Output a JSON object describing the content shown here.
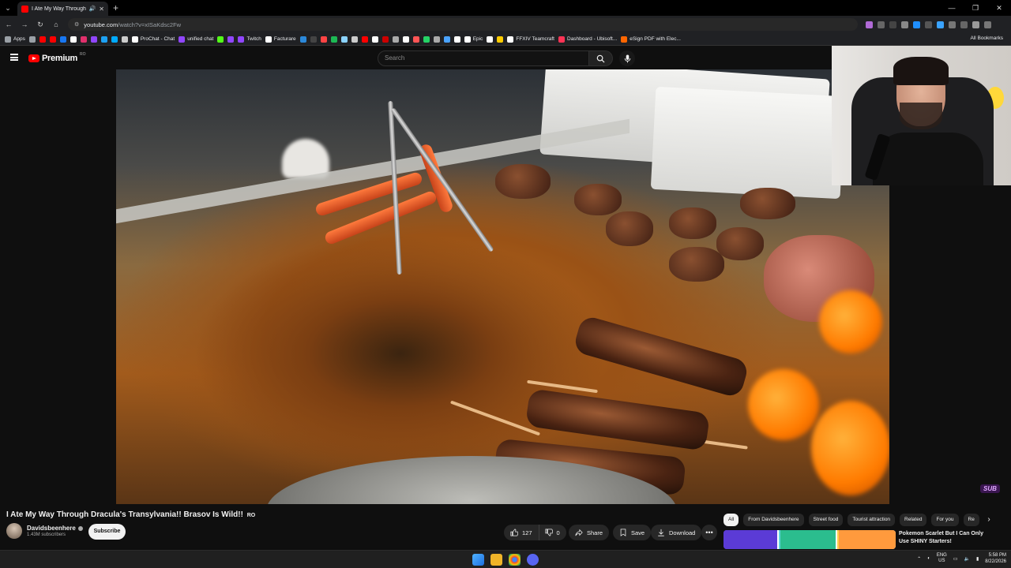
{
  "browser": {
    "tab_title": "I Ate My Way Through Dra...",
    "url_host": "youtube.com",
    "url_path": "/watch?v=xISaKdsc2Fw",
    "bookmarks": [
      {
        "label": "Apps",
        "color": "#9aa0a6"
      },
      {
        "label": "",
        "color": "#9aa0a6"
      },
      {
        "label": "",
        "color": "#ff0000"
      },
      {
        "label": "",
        "color": "#ff0000"
      },
      {
        "label": "",
        "color": "#1877f2"
      },
      {
        "label": "",
        "color": "#ffffff"
      },
      {
        "label": "",
        "color": "#e1306c"
      },
      {
        "label": "",
        "color": "#9146ff"
      },
      {
        "label": "",
        "color": "#1da1f2"
      },
      {
        "label": "",
        "color": "#00aaff"
      },
      {
        "label": "",
        "color": "#cccccc"
      },
      {
        "label": "ProChat - Chat",
        "color": "#ffffff"
      },
      {
        "label": "unified chat",
        "color": "#9146ff"
      },
      {
        "label": "",
        "color": "#53fc18"
      },
      {
        "label": "",
        "color": "#9146ff"
      },
      {
        "label": "Twitch",
        "color": "#9146ff"
      },
      {
        "label": "Facturare",
        "color": "#ffffff"
      },
      {
        "label": "",
        "color": "#2b88d9"
      },
      {
        "label": "",
        "color": "#444444"
      },
      {
        "label": "",
        "color": "#ff4444"
      },
      {
        "label": "",
        "color": "#1db954"
      },
      {
        "label": "",
        "color": "#8bd3ff"
      },
      {
        "label": "",
        "color": "#cccccc"
      },
      {
        "label": "",
        "color": "#ff0000"
      },
      {
        "label": "",
        "color": "#ffffff"
      },
      {
        "label": "",
        "color": "#cc0000"
      },
      {
        "label": "",
        "color": "#aaaaaa"
      },
      {
        "label": "",
        "color": "#ffffff"
      },
      {
        "label": "",
        "color": "#ff5555"
      },
      {
        "label": "",
        "color": "#25d366"
      },
      {
        "label": "",
        "color": "#aaaaaa"
      },
      {
        "label": "",
        "color": "#4aa3ff"
      },
      {
        "label": "",
        "color": "#ffffff"
      },
      {
        "label": "Epic",
        "color": "#ffffff"
      },
      {
        "label": "",
        "color": "#ffffff"
      },
      {
        "label": "",
        "color": "#ffcc00"
      },
      {
        "label": "FFXIV Teamcraft",
        "color": "#ffffff"
      },
      {
        "label": "Dashboard - Ubisoft...",
        "color": "#ff3355"
      },
      {
        "label": "eSign PDF with Elec...",
        "color": "#ff6600"
      }
    ],
    "all_bookmarks": "All Bookmarks"
  },
  "youtube": {
    "logo_text": "Premium",
    "logo_country": "RO",
    "search_placeholder": "Search"
  },
  "video": {
    "title": "I Ate My Way Through Dracula's Transylvania!! Brasov Is Wild!!",
    "title_suffix": "RO",
    "channel_name": "Davidsbeenhere",
    "subscribers": "1.43M subscribers",
    "subscribe_label": "Subscribe",
    "likes": "127",
    "dislikes": "0",
    "share_label": "Share",
    "save_label": "Save",
    "download_label": "Download",
    "sub_badge": "SUB"
  },
  "chips": [
    "All",
    "From Davidsbeenhere",
    "Street food",
    "Tourist attraction",
    "Related",
    "For you",
    "Re"
  ],
  "recommendation": {
    "title": "Pokemon Scarlet But I Can Only Use SHINY Starters!"
  },
  "taskbar": {
    "lang_line1": "ENG",
    "lang_line2": "US",
    "time": "5:58 PM",
    "date": "8/22/2026"
  }
}
